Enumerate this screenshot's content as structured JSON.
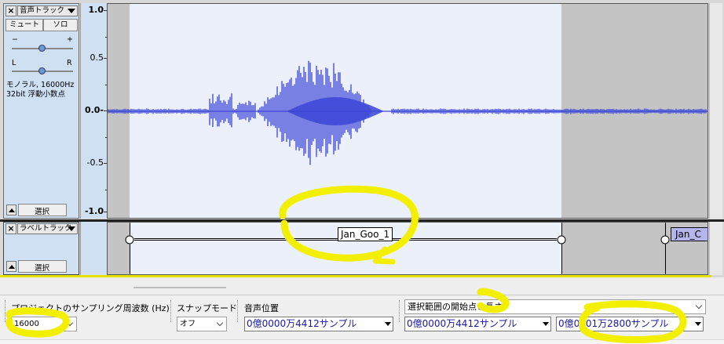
{
  "audio_track": {
    "name": "音声トラック",
    "mute_label": "ミュート",
    "solo_label": "ソロ",
    "gain_minus": "−",
    "gain_plus": "+",
    "pan_left": "L",
    "pan_right": "R",
    "info_line1": "モノラル, 16000Hz",
    "info_line2": "32bit 浮動小数点",
    "select_label": "選択",
    "close_glyph": "×",
    "scale": [
      "1.0",
      "0.5",
      "0.0-",
      "-0.5",
      "-1.0"
    ],
    "wave_color": "#3b45d6",
    "gain_level": 0.5,
    "pan_level": 0.5
  },
  "label_track": {
    "name": "ラベルトラック",
    "select_label": "選択",
    "close_glyph": "×",
    "label1": "Jan_Goo_1",
    "label2": "Jan_C"
  },
  "toolbar": {
    "rate_label": "プロジェクトのサンプリング周波数 (Hz)",
    "rate_value": "16000",
    "snap_label": "スナップモード",
    "snap_value": "オフ",
    "audio_pos_label": "音声位置",
    "audio_pos_value": "0億0000万4412サンプル",
    "selection_mode": "選択範囲の開始点と長さ",
    "sel_start_value": "0億0000万4412サンプル",
    "sel_length_value": "0億0001万2800サンプル"
  },
  "colors": {
    "track_bg": "#ebf0fb",
    "panel_bg": "#cfe0f2",
    "highlight": "#f2ef00",
    "time_text": "#1a1aa0"
  }
}
